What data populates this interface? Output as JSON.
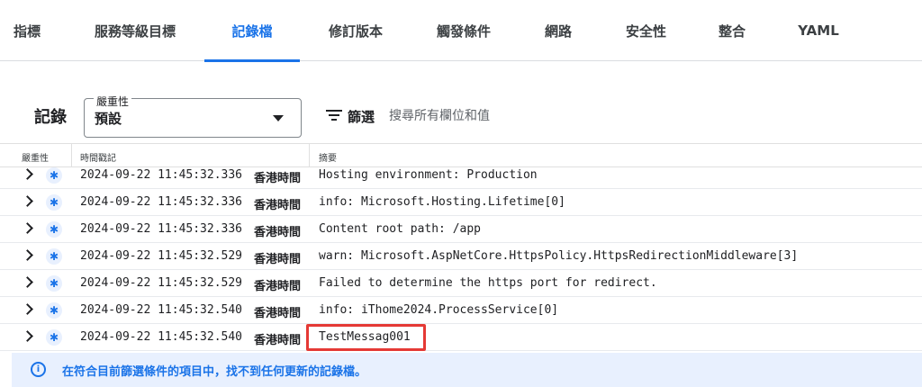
{
  "tabs": [
    {
      "label": "指標"
    },
    {
      "label": "服務等級目標"
    },
    {
      "label": "記錄檔"
    },
    {
      "label": "修訂版本"
    },
    {
      "label": "觸發條件"
    },
    {
      "label": "網路"
    },
    {
      "label": "安全性"
    },
    {
      "label": "整合"
    },
    {
      "label": "YAML"
    }
  ],
  "active_tab": "記錄檔",
  "toolbar": {
    "title": "記錄",
    "severity_label": "嚴重性",
    "severity_value": "預設",
    "filter_label": "篩選",
    "search_placeholder": "搜尋所有欄位和值"
  },
  "table": {
    "headers": {
      "severity": "嚴重性",
      "timestamp": "時間戳記",
      "summary": "摘要"
    },
    "rows": [
      {
        "timestamp": "2024-09-22 11:45:32.336",
        "tz": "香港時間",
        "summary": "Hosting environment: Production"
      },
      {
        "timestamp": "2024-09-22 11:45:32.336",
        "tz": "香港時間",
        "summary": "info: Microsoft.Hosting.Lifetime[0]"
      },
      {
        "timestamp": "2024-09-22 11:45:32.336",
        "tz": "香港時間",
        "summary": "Content root path: /app"
      },
      {
        "timestamp": "2024-09-22 11:45:32.529",
        "tz": "香港時間",
        "summary": "warn: Microsoft.AspNetCore.HttpsPolicy.HttpsRedirectionMiddleware[3]"
      },
      {
        "timestamp": "2024-09-22 11:45:32.529",
        "tz": "香港時間",
        "summary": "Failed to determine the https port for redirect."
      },
      {
        "timestamp": "2024-09-22 11:45:32.540",
        "tz": "香港時間",
        "summary": "info: iThome2024.ProcessService[0]"
      },
      {
        "timestamp": "2024-09-22 11:45:32.540",
        "tz": "香港時間",
        "summary": "TestMessag001"
      }
    ]
  },
  "banner": {
    "text": "在符合目前篩選條件的項目中，找不到任何更新的記錄檔。"
  },
  "colors": {
    "accent": "#1a73e8",
    "highlight": "#e53935",
    "banner_bg": "#e8f0fe"
  },
  "icons": {
    "severity": "asterisk-icon",
    "expand": "chevron-right-icon",
    "filter": "filter-list-icon",
    "info": "info-icon",
    "dropdown": "arrow-drop-down-icon"
  }
}
